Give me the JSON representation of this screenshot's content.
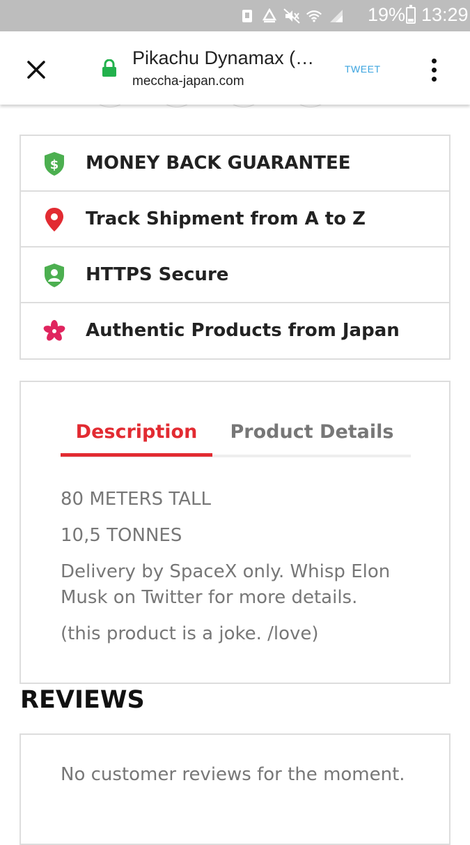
{
  "status_bar": {
    "battery_percent": "19%",
    "time": "13:29",
    "icons": [
      "usb-icon",
      "recycle-icon",
      "mute-icon",
      "wifi-icon",
      "signal-icon",
      "battery-icon"
    ]
  },
  "toolbar": {
    "title": "Pikachu Dynamax (…",
    "url": "meccha-japan.com",
    "tweet_label": "TWEET"
  },
  "guarantees": [
    {
      "label": "MONEY BACK GUARANTEE",
      "icon": "dollar-shield-icon",
      "color": "#4caf50"
    },
    {
      "label": "Track Shipment from A to Z",
      "icon": "map-pin-icon",
      "color": "#e22b32"
    },
    {
      "label": "HTTPS Secure",
      "icon": "user-shield-icon",
      "color": "#4caf50"
    },
    {
      "label": "Authentic Products from Japan",
      "icon": "sakura-icon",
      "color": "#e0245e"
    }
  ],
  "tabs": {
    "description": "Description",
    "product_details": "Product Details"
  },
  "description": {
    "lines": [
      "80 METERS TALL",
      "10,5 TONNES",
      "Delivery by SpaceX only. Whisp Elon Musk on Twitter for more details.",
      "(this product is a joke. /love)"
    ]
  },
  "reviews": {
    "heading": "REVIEWS",
    "empty_message": "No customer reviews for the moment."
  },
  "colors": {
    "accent": "#e22b32",
    "green": "#4caf50",
    "link_blue": "#3aa3df"
  }
}
